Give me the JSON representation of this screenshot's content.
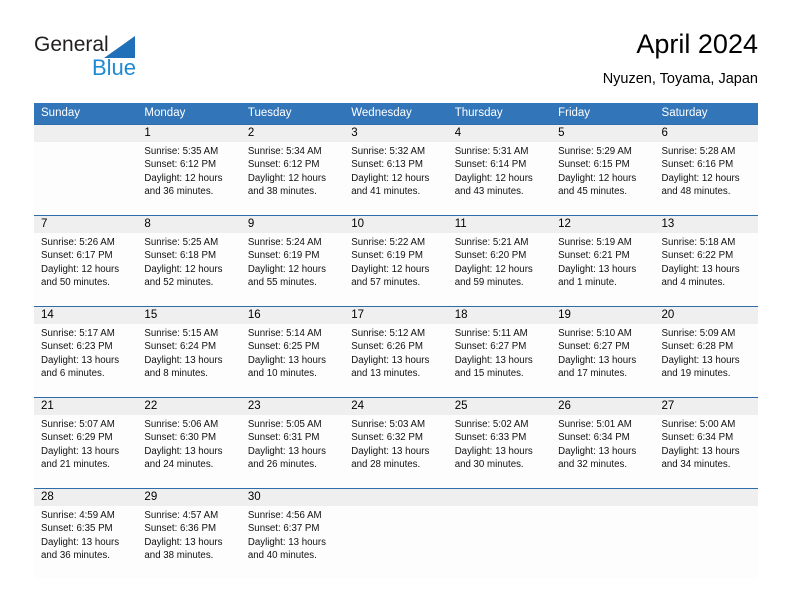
{
  "brand": {
    "line1": "General",
    "line2": "Blue",
    "triangle_color": "#1f70b8",
    "line2_color": "#1f8ad4"
  },
  "header": {
    "title": "April 2024",
    "location": "Nyuzen, Toyama, Japan"
  },
  "theme": {
    "header_blue": "#3275b8",
    "row_divider_blue": "#2e6da8",
    "day_band_gray": "#efefef"
  },
  "weekdays": [
    "Sunday",
    "Monday",
    "Tuesday",
    "Wednesday",
    "Thursday",
    "Friday",
    "Saturday"
  ],
  "weeks": [
    {
      "days": [
        {
          "num": "",
          "sunrise": "",
          "sunset": "",
          "daylight_1": "",
          "daylight_2": ""
        },
        {
          "num": "1",
          "sunrise": "Sunrise: 5:35 AM",
          "sunset": "Sunset: 6:12 PM",
          "daylight_1": "Daylight: 12 hours",
          "daylight_2": "and 36 minutes."
        },
        {
          "num": "2",
          "sunrise": "Sunrise: 5:34 AM",
          "sunset": "Sunset: 6:12 PM",
          "daylight_1": "Daylight: 12 hours",
          "daylight_2": "and 38 minutes."
        },
        {
          "num": "3",
          "sunrise": "Sunrise: 5:32 AM",
          "sunset": "Sunset: 6:13 PM",
          "daylight_1": "Daylight: 12 hours",
          "daylight_2": "and 41 minutes."
        },
        {
          "num": "4",
          "sunrise": "Sunrise: 5:31 AM",
          "sunset": "Sunset: 6:14 PM",
          "daylight_1": "Daylight: 12 hours",
          "daylight_2": "and 43 minutes."
        },
        {
          "num": "5",
          "sunrise": "Sunrise: 5:29 AM",
          "sunset": "Sunset: 6:15 PM",
          "daylight_1": "Daylight: 12 hours",
          "daylight_2": "and 45 minutes."
        },
        {
          "num": "6",
          "sunrise": "Sunrise: 5:28 AM",
          "sunset": "Sunset: 6:16 PM",
          "daylight_1": "Daylight: 12 hours",
          "daylight_2": "and 48 minutes."
        }
      ]
    },
    {
      "days": [
        {
          "num": "7",
          "sunrise": "Sunrise: 5:26 AM",
          "sunset": "Sunset: 6:17 PM",
          "daylight_1": "Daylight: 12 hours",
          "daylight_2": "and 50 minutes."
        },
        {
          "num": "8",
          "sunrise": "Sunrise: 5:25 AM",
          "sunset": "Sunset: 6:18 PM",
          "daylight_1": "Daylight: 12 hours",
          "daylight_2": "and 52 minutes."
        },
        {
          "num": "9",
          "sunrise": "Sunrise: 5:24 AM",
          "sunset": "Sunset: 6:19 PM",
          "daylight_1": "Daylight: 12 hours",
          "daylight_2": "and 55 minutes."
        },
        {
          "num": "10",
          "sunrise": "Sunrise: 5:22 AM",
          "sunset": "Sunset: 6:19 PM",
          "daylight_1": "Daylight: 12 hours",
          "daylight_2": "and 57 minutes."
        },
        {
          "num": "11",
          "sunrise": "Sunrise: 5:21 AM",
          "sunset": "Sunset: 6:20 PM",
          "daylight_1": "Daylight: 12 hours",
          "daylight_2": "and 59 minutes."
        },
        {
          "num": "12",
          "sunrise": "Sunrise: 5:19 AM",
          "sunset": "Sunset: 6:21 PM",
          "daylight_1": "Daylight: 13 hours",
          "daylight_2": "and 1 minute."
        },
        {
          "num": "13",
          "sunrise": "Sunrise: 5:18 AM",
          "sunset": "Sunset: 6:22 PM",
          "daylight_1": "Daylight: 13 hours",
          "daylight_2": "and 4 minutes."
        }
      ]
    },
    {
      "days": [
        {
          "num": "14",
          "sunrise": "Sunrise: 5:17 AM",
          "sunset": "Sunset: 6:23 PM",
          "daylight_1": "Daylight: 13 hours",
          "daylight_2": "and 6 minutes."
        },
        {
          "num": "15",
          "sunrise": "Sunrise: 5:15 AM",
          "sunset": "Sunset: 6:24 PM",
          "daylight_1": "Daylight: 13 hours",
          "daylight_2": "and 8 minutes."
        },
        {
          "num": "16",
          "sunrise": "Sunrise: 5:14 AM",
          "sunset": "Sunset: 6:25 PM",
          "daylight_1": "Daylight: 13 hours",
          "daylight_2": "and 10 minutes."
        },
        {
          "num": "17",
          "sunrise": "Sunrise: 5:12 AM",
          "sunset": "Sunset: 6:26 PM",
          "daylight_1": "Daylight: 13 hours",
          "daylight_2": "and 13 minutes."
        },
        {
          "num": "18",
          "sunrise": "Sunrise: 5:11 AM",
          "sunset": "Sunset: 6:27 PM",
          "daylight_1": "Daylight: 13 hours",
          "daylight_2": "and 15 minutes."
        },
        {
          "num": "19",
          "sunrise": "Sunrise: 5:10 AM",
          "sunset": "Sunset: 6:27 PM",
          "daylight_1": "Daylight: 13 hours",
          "daylight_2": "and 17 minutes."
        },
        {
          "num": "20",
          "sunrise": "Sunrise: 5:09 AM",
          "sunset": "Sunset: 6:28 PM",
          "daylight_1": "Daylight: 13 hours",
          "daylight_2": "and 19 minutes."
        }
      ]
    },
    {
      "days": [
        {
          "num": "21",
          "sunrise": "Sunrise: 5:07 AM",
          "sunset": "Sunset: 6:29 PM",
          "daylight_1": "Daylight: 13 hours",
          "daylight_2": "and 21 minutes."
        },
        {
          "num": "22",
          "sunrise": "Sunrise: 5:06 AM",
          "sunset": "Sunset: 6:30 PM",
          "daylight_1": "Daylight: 13 hours",
          "daylight_2": "and 24 minutes."
        },
        {
          "num": "23",
          "sunrise": "Sunrise: 5:05 AM",
          "sunset": "Sunset: 6:31 PM",
          "daylight_1": "Daylight: 13 hours",
          "daylight_2": "and 26 minutes."
        },
        {
          "num": "24",
          "sunrise": "Sunrise: 5:03 AM",
          "sunset": "Sunset: 6:32 PM",
          "daylight_1": "Daylight: 13 hours",
          "daylight_2": "and 28 minutes."
        },
        {
          "num": "25",
          "sunrise": "Sunrise: 5:02 AM",
          "sunset": "Sunset: 6:33 PM",
          "daylight_1": "Daylight: 13 hours",
          "daylight_2": "and 30 minutes."
        },
        {
          "num": "26",
          "sunrise": "Sunrise: 5:01 AM",
          "sunset": "Sunset: 6:34 PM",
          "daylight_1": "Daylight: 13 hours",
          "daylight_2": "and 32 minutes."
        },
        {
          "num": "27",
          "sunrise": "Sunrise: 5:00 AM",
          "sunset": "Sunset: 6:34 PM",
          "daylight_1": "Daylight: 13 hours",
          "daylight_2": "and 34 minutes."
        }
      ]
    },
    {
      "days": [
        {
          "num": "28",
          "sunrise": "Sunrise: 4:59 AM",
          "sunset": "Sunset: 6:35 PM",
          "daylight_1": "Daylight: 13 hours",
          "daylight_2": "and 36 minutes."
        },
        {
          "num": "29",
          "sunrise": "Sunrise: 4:57 AM",
          "sunset": "Sunset: 6:36 PM",
          "daylight_1": "Daylight: 13 hours",
          "daylight_2": "and 38 minutes."
        },
        {
          "num": "30",
          "sunrise": "Sunrise: 4:56 AM",
          "sunset": "Sunset: 6:37 PM",
          "daylight_1": "Daylight: 13 hours",
          "daylight_2": "and 40 minutes."
        },
        {
          "num": "",
          "sunrise": "",
          "sunset": "",
          "daylight_1": "",
          "daylight_2": ""
        },
        {
          "num": "",
          "sunrise": "",
          "sunset": "",
          "daylight_1": "",
          "daylight_2": ""
        },
        {
          "num": "",
          "sunrise": "",
          "sunset": "",
          "daylight_1": "",
          "daylight_2": ""
        },
        {
          "num": "",
          "sunrise": "",
          "sunset": "",
          "daylight_1": "",
          "daylight_2": ""
        }
      ]
    }
  ]
}
